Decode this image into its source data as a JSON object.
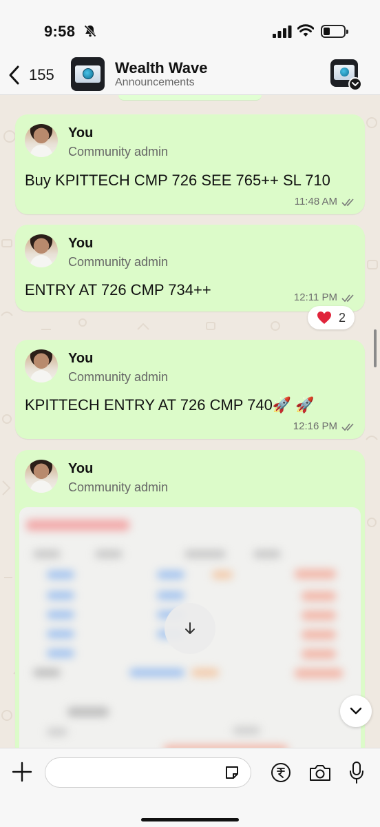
{
  "status_bar": {
    "time": "9:58",
    "icons": [
      "bell-slash-icon",
      "signal-icon",
      "wifi-icon",
      "battery-icon"
    ]
  },
  "header": {
    "back_count": "155",
    "title": "Wealth Wave",
    "subtitle": "Announcements"
  },
  "messages": [
    {
      "sender": "You",
      "role": "Community admin",
      "text": "Buy KPITTECH CMP 726 SEE 765++ SL 710",
      "time": "11:48 AM"
    },
    {
      "sender": "You",
      "role": "Community admin",
      "text": "ENTRY AT 726 CMP 734++",
      "time": "12:11 PM",
      "reaction": {
        "emoji": "heart-icon",
        "count": "2"
      }
    },
    {
      "sender": "You",
      "role": "Community admin",
      "text": "KPITTECH ENTRY AT 726 CMP 740🚀 🚀",
      "time": "12:16 PM"
    },
    {
      "sender": "You",
      "role": "Community admin",
      "attachment": "blurred-image"
    }
  ],
  "input": {
    "placeholder": ""
  },
  "colors": {
    "bubble": "#dcfbc9",
    "background": "#efe9e1",
    "bar": "#f7f7f7"
  }
}
